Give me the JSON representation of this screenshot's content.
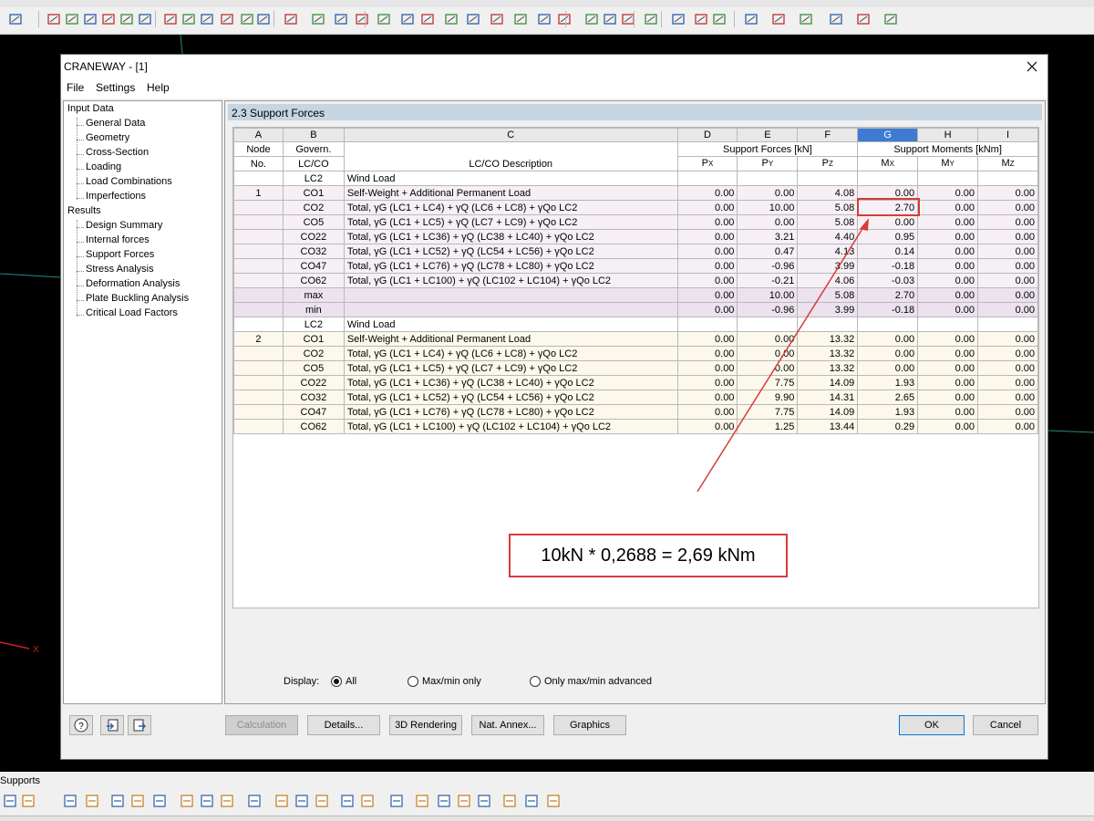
{
  "dialog": {
    "title": "CRANEWAY - [1]",
    "menu": [
      "File",
      "Settings",
      "Help"
    ]
  },
  "nav": {
    "input_root": "Input Data",
    "input_items": [
      "General Data",
      "Geometry",
      "Cross-Section",
      "Loading",
      "Load Combinations",
      "Imperfections"
    ],
    "results_root": "Results",
    "results_items": [
      "Design Summary",
      "Internal forces",
      "Support Forces",
      "Stress Analysis",
      "Deformation Analysis",
      "Plate Buckling Analysis",
      "Critical Load Factors"
    ]
  },
  "section_title": "2.3 Support Forces",
  "table": {
    "letters": [
      "A",
      "B",
      "C",
      "D",
      "E",
      "F",
      "G",
      "H",
      "I"
    ],
    "hdr_node": "Node",
    "hdr_no": "No.",
    "hdr_govern": "Govern.",
    "hdr_lcco": "LC/CO",
    "hdr_desc": "LC/CO Description",
    "hdr_forces": "Support Forces [kN]",
    "hdr_moments": "Support Moments [kNm]",
    "sub": [
      {
        "main": "P",
        "sub": "X"
      },
      {
        "main": "P",
        "sub": "Y"
      },
      {
        "main": "P",
        "sub": "Z"
      },
      {
        "main": "M",
        "sub": "X"
      },
      {
        "main": "M",
        "sub": "Y"
      },
      {
        "main": "M",
        "sub": "Z"
      }
    ],
    "rows": [
      {
        "style": "white",
        "node": "",
        "lc": "LC2",
        "desc": "Wind Load",
        "v": [
          "",
          "",
          "",
          "",
          "",
          ""
        ]
      },
      {
        "style": "pink",
        "node": "1",
        "lc": "CO1",
        "desc": "Self-Weight + Additional Permanent Load",
        "v": [
          "0.00",
          "0.00",
          "4.08",
          "0.00",
          "0.00",
          "0.00"
        ]
      },
      {
        "style": "pink",
        "node": "",
        "lc": "CO2",
        "desc": "Total, γG (LC1 + LC4) + γQ (LC6 + LC8) + γQo LC2",
        "v": [
          "0.00",
          "10.00",
          "5.08",
          "2.70",
          "0.00",
          "0.00"
        ]
      },
      {
        "style": "pink",
        "node": "",
        "lc": "CO5",
        "desc": "Total, γG (LC1 + LC5) + γQ (LC7 + LC9) + γQo LC2",
        "v": [
          "0.00",
          "0.00",
          "5.08",
          "0.00",
          "0.00",
          "0.00"
        ]
      },
      {
        "style": "pink",
        "node": "",
        "lc": "CO22",
        "desc": "Total, γG (LC1 + LC36) + γQ (LC38 + LC40) + γQo LC2",
        "v": [
          "0.00",
          "3.21",
          "4.40",
          "0.95",
          "0.00",
          "0.00"
        ]
      },
      {
        "style": "pink",
        "node": "",
        "lc": "CO32",
        "desc": "Total, γG (LC1 + LC52) + γQ (LC54 + LC56) + γQo LC2",
        "v": [
          "0.00",
          "0.47",
          "4.13",
          "0.14",
          "0.00",
          "0.00"
        ]
      },
      {
        "style": "pink",
        "node": "",
        "lc": "CO47",
        "desc": "Total, γG (LC1 + LC76) + γQ (LC78 + LC80) + γQo LC2",
        "v": [
          "0.00",
          "-0.96",
          "3.99",
          "-0.18",
          "0.00",
          "0.00"
        ]
      },
      {
        "style": "pink",
        "node": "",
        "lc": "CO62",
        "desc": "Total, γG (LC1 + LC100) + γQ (LC102 + LC104) + γQo LC2",
        "v": [
          "0.00",
          "-0.21",
          "4.06",
          "-0.03",
          "0.00",
          "0.00"
        ]
      },
      {
        "style": "mm",
        "node": "",
        "lc": "max",
        "desc": "",
        "v": [
          "0.00",
          "10.00",
          "5.08",
          "2.70",
          "0.00",
          "0.00"
        ]
      },
      {
        "style": "mm",
        "node": "",
        "lc": "min",
        "desc": "",
        "v": [
          "0.00",
          "-0.96",
          "3.99",
          "-0.18",
          "0.00",
          "0.00"
        ]
      },
      {
        "style": "white",
        "node": "",
        "lc": "LC2",
        "desc": "Wind Load",
        "v": [
          "",
          "",
          "",
          "",
          "",
          ""
        ]
      },
      {
        "style": "yellow",
        "node": "2",
        "lc": "CO1",
        "desc": "Self-Weight + Additional Permanent Load",
        "v": [
          "0.00",
          "0.00",
          "13.32",
          "0.00",
          "0.00",
          "0.00"
        ]
      },
      {
        "style": "yellow",
        "node": "",
        "lc": "CO2",
        "desc": "Total, γG (LC1 + LC4) + γQ (LC6 + LC8) + γQo LC2",
        "v": [
          "0.00",
          "0.00",
          "13.32",
          "0.00",
          "0.00",
          "0.00"
        ]
      },
      {
        "style": "yellow",
        "node": "",
        "lc": "CO5",
        "desc": "Total, γG (LC1 + LC5) + γQ (LC7 + LC9) + γQo LC2",
        "v": [
          "0.00",
          "0.00",
          "13.32",
          "0.00",
          "0.00",
          "0.00"
        ]
      },
      {
        "style": "yellow",
        "node": "",
        "lc": "CO22",
        "desc": "Total, γG (LC1 + LC36) + γQ (LC38 + LC40) + γQo LC2",
        "v": [
          "0.00",
          "7.75",
          "14.09",
          "1.93",
          "0.00",
          "0.00"
        ]
      },
      {
        "style": "yellow",
        "node": "",
        "lc": "CO32",
        "desc": "Total, γG (LC1 + LC52) + γQ (LC54 + LC56) + γQo LC2",
        "v": [
          "0.00",
          "9.90",
          "14.31",
          "2.65",
          "0.00",
          "0.00"
        ]
      },
      {
        "style": "yellow",
        "node": "",
        "lc": "CO47",
        "desc": "Total, γG (LC1 + LC76) + γQ (LC78 + LC80) + γQo LC2",
        "v": [
          "0.00",
          "7.75",
          "14.09",
          "1.93",
          "0.00",
          "0.00"
        ]
      },
      {
        "style": "yellow",
        "node": "",
        "lc": "CO62",
        "desc": "Total, γG (LC1 + LC100) + γQ (LC102 + LC104) + γQo LC2",
        "v": [
          "0.00",
          "1.25",
          "13.44",
          "0.29",
          "0.00",
          "0.00"
        ]
      }
    ]
  },
  "annotation": "10kN * 0,2688 = 2,69 kNm",
  "display": {
    "label": "Display:",
    "options": [
      "All",
      "Max/min only",
      "Only max/min advanced"
    ],
    "selected": "All"
  },
  "buttons": {
    "calculation": "Calculation",
    "details": "Details...",
    "rendering": "3D Rendering",
    "nat_annex": "Nat. Annex...",
    "graphics": "Graphics",
    "ok": "OK",
    "cancel": "Cancel"
  },
  "bottom_panel": {
    "title": "Supports"
  },
  "viewport": {
    "axis_label": "X"
  },
  "colors": {
    "header_blue": "#c5d5e2",
    "selected_column": "#3d7cd0",
    "annotation_red": "#d83b3b"
  }
}
